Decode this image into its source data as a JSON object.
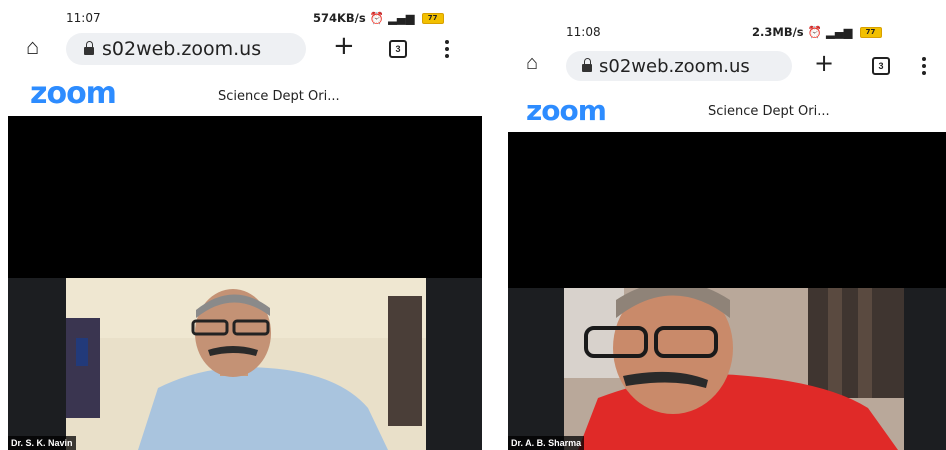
{
  "screens": [
    {
      "time": "11:07",
      "network_speed": "574KB/s",
      "battery": "77",
      "url": "s02web.zoom.us",
      "tab_count": "3",
      "logo": "zoom",
      "meeting_title": "Science Dept Ori...",
      "participant": "Dr. S. K. Navin"
    },
    {
      "time": "11:08",
      "network_speed": "2.3MB/s",
      "battery": "77",
      "url": "s02web.zoom.us",
      "tab_count": "3",
      "logo": "zoom",
      "meeting_title": "Science Dept Ori...",
      "participant": "Dr. A. B. Sharma"
    }
  ],
  "colors": {
    "zoom_blue": "#2d8cff",
    "video_bg": "#000000",
    "battery": "#f2c000"
  }
}
